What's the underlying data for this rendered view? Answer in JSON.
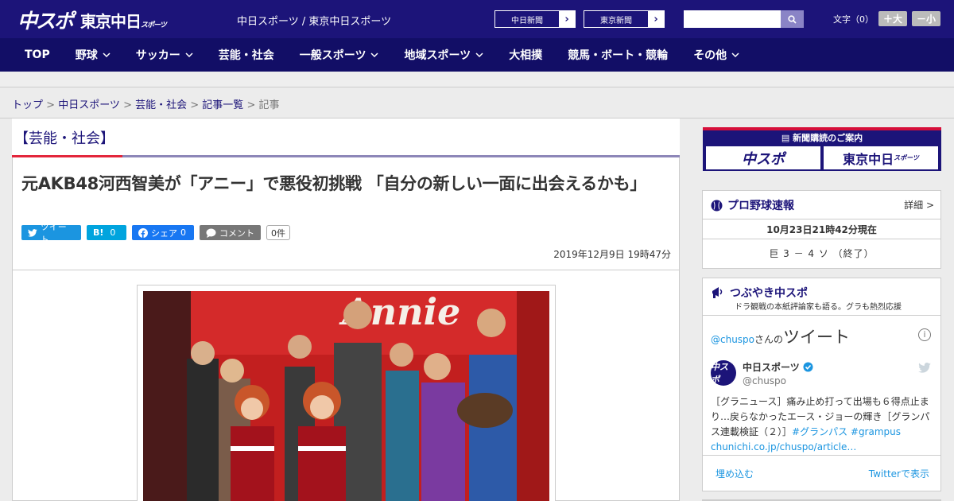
{
  "header": {
    "logo_main": "中スポ",
    "logo_sub": "東京中日",
    "logo_sub_small": "スポーツ",
    "site_links": "中日スポーツ / 東京中日スポーツ",
    "paper_buttons": [
      "中日新聞",
      "東京新聞"
    ],
    "search_placeholder": "",
    "font_label": "文字（0）",
    "font_bigger": "＋大",
    "font_smaller": "－小"
  },
  "nav": {
    "items": [
      {
        "label": "TOP",
        "dropdown": false
      },
      {
        "label": "野球",
        "dropdown": true
      },
      {
        "label": "サッカー",
        "dropdown": true
      },
      {
        "label": "芸能・社会",
        "dropdown": false
      },
      {
        "label": "一般スポーツ",
        "dropdown": true
      },
      {
        "label": "地域スポーツ",
        "dropdown": true
      },
      {
        "label": "大相撲",
        "dropdown": false
      },
      {
        "label": "競馬・ボート・競輪",
        "dropdown": false
      },
      {
        "label": "その他",
        "dropdown": true
      }
    ]
  },
  "breadcrumb": {
    "items": [
      "トップ",
      "中日スポーツ",
      "芸能・社会",
      "記事一覧"
    ],
    "current": "記事",
    "separator": " > "
  },
  "article": {
    "category": "【芸能・社会】",
    "headline": "元AKB48河西智美が「アニー」で悪役初挑戦 「自分の新しい一面に出会えるかも」",
    "share": {
      "tweet_label": "ツイート",
      "hatena_label": "B!",
      "hatena_count": "0",
      "facebook_label": "シェア",
      "facebook_count": "0",
      "comment_label": "コメント",
      "comment_count": "0件"
    },
    "date": "2019年12月9日 19時47分",
    "photo_sign": "Annie"
  },
  "sidebar": {
    "subscribe": {
      "title": "新聞購読のご案内",
      "papers": [
        "中スポ",
        "東京中日"
      ],
      "paper_small": "スポーツ"
    },
    "baseball": {
      "title": "プロ野球速報",
      "more": "詳細 >",
      "time": "10月23日21時42分現在",
      "score": "巨 3 － 4 ソ （終了）"
    },
    "tweets": {
      "title": "つぶやき中スポ",
      "subtitle": "ドラ観戦の本紙評論家も語る。グラも熱烈応援",
      "account_prefix": "@chuspo",
      "account_suffix": "さんの",
      "heading": "ツイート",
      "user_name": "中日スポーツ",
      "user_handle": "@chuspo",
      "avatar_text": "中スポ",
      "text": "［グラニュース］痛み止め打って出場も６得点止まり…戻らなかったエース・ジョーの輝き［グランパス連載検証（２）］",
      "hashtags": "#グランパス #grampus",
      "link": "chunichi.co.jp/chuspo/article…",
      "embed": "埋め込む",
      "view_on": "Twitterで表示"
    }
  },
  "colors": {
    "brand_navy": "#1c1479",
    "nav_navy": "#120e66",
    "accent_red": "#e3263b",
    "twitter_blue": "#1b95e0"
  }
}
